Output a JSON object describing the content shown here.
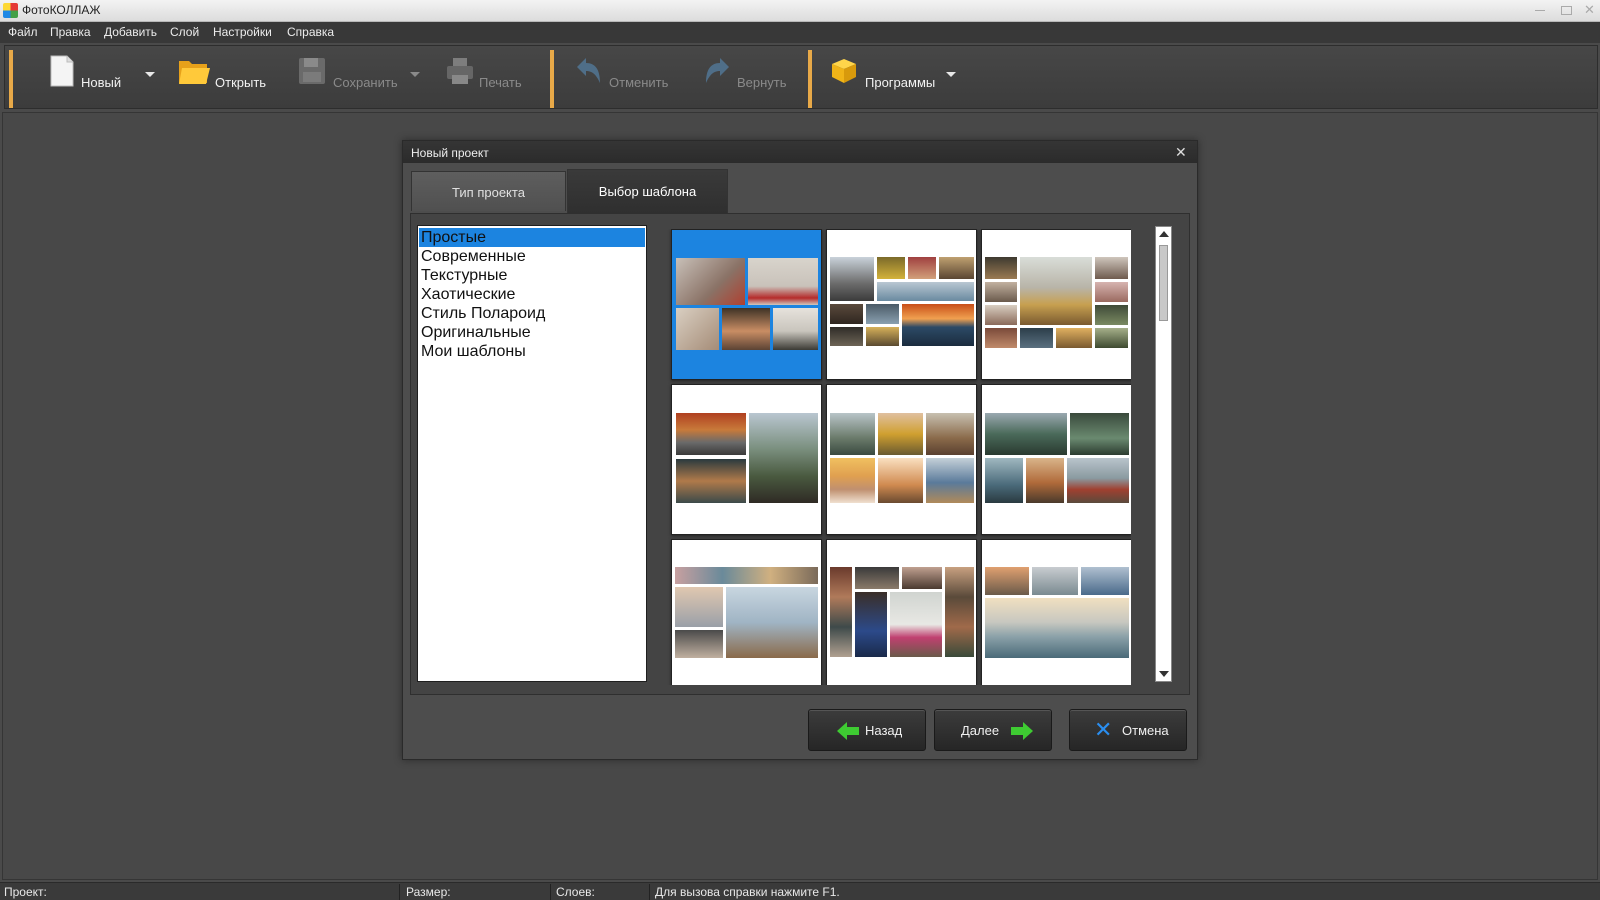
{
  "window": {
    "title": "ФотоКОЛЛАЖ"
  },
  "menu": [
    "Файл",
    "Правка",
    "Добавить",
    "Слой",
    "Настройки",
    "Справка"
  ],
  "toolbar": {
    "new_label": "Новый",
    "open_label": "Открыть",
    "save_label": "Сохранить",
    "print_label": "Печать",
    "undo_label": "Отменить",
    "redo_label": "Вернуть",
    "programs_label": "Программы"
  },
  "dialog": {
    "title": "Новый проект",
    "tabs": [
      "Тип проекта",
      "Выбор шаблона"
    ],
    "active_tab": "Выбор шаблона",
    "categories": [
      "Простые",
      "Современные",
      "Текстурные",
      "Хаотические",
      "Стиль Полароид",
      "Оригинальные",
      "Мои шаблоны"
    ],
    "selected_category": "Простые",
    "buttons": {
      "back": "Назад",
      "next": "Далее",
      "cancel": "Отмена"
    }
  },
  "statusbar": {
    "project": "Проект:",
    "size": "Размер:",
    "layers": "Слоев:",
    "hint": "Для вызова справки нажмите F1."
  },
  "colors": {
    "accent": "#1c84e0",
    "toolbar_separator": "#e8a948",
    "arrow_green": "#3ecb32",
    "cancel_blue": "#2a8ef0"
  }
}
